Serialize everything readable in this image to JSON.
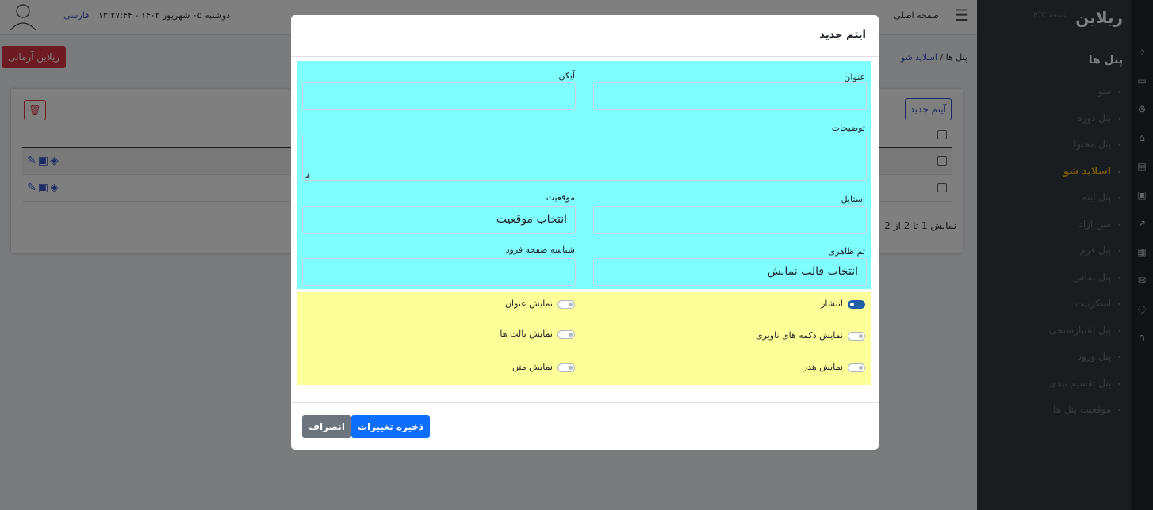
{
  "header": {
    "language": "فارسی",
    "datetime": "دوشنبه ۰۵ شهریور ۱۴۰۳ - ۱۳:۲۷:۴۴",
    "home_link": "صفحه اصلی"
  },
  "subbar": {
    "brand_button": "ریلاین آرمانی",
    "breadcrumb_parent": "پنل ها",
    "breadcrumb_separator": "/",
    "breadcrumb_current": "اسلاید شو"
  },
  "card": {
    "new_item_button": "آیتم جدید",
    "pager_text": "نمایش 1 تا 2 از 2"
  },
  "sidebar": {
    "logo": "ریلاین",
    "version": "نسخه PTC",
    "title": "پنل ها",
    "items": [
      {
        "label": "منو"
      },
      {
        "label": "پنل دوره"
      },
      {
        "label": "پنل محتوا"
      },
      {
        "label": "اسلاید شو",
        "active": true
      },
      {
        "label": "پنل آیتم"
      },
      {
        "label": "متن آزاد"
      },
      {
        "label": "پنل فرم"
      },
      {
        "label": "پنل تماس"
      },
      {
        "label": "اسکریپت"
      },
      {
        "label": "پنل اعتبارسنجی"
      },
      {
        "label": "پنل ورود"
      },
      {
        "label": "پنل تقسیم بندی"
      },
      {
        "label": "موقعیت پنل ها"
      }
    ]
  },
  "modal": {
    "title": "آیتم جدید",
    "fields": {
      "title_label": "عنوان",
      "title_value": "",
      "icon_label": "آیکن",
      "icon_value": "",
      "description_label": "توضیحات",
      "description_value": "",
      "style_label": "استایل",
      "style_value": "",
      "position_label": "موقعیت",
      "position_value": "انتخاب موقعیت",
      "theme_label": "تم ظاهری",
      "theme_value": "انتخاب قالب نمایش",
      "landing_label": "شناسه صفحه فرود",
      "landing_value": ""
    },
    "toggles": {
      "publish": {
        "label": "انتشار",
        "on": true
      },
      "show_title": {
        "label": "نمایش عنوان",
        "on": false
      },
      "show_nav_buttons": {
        "label": "نمایش دکمه های ناوبری",
        "on": false
      },
      "show_bullets": {
        "label": "نمایش بالت ها",
        "on": false
      },
      "show_header": {
        "label": "نمایش هدر",
        "on": false
      },
      "show_text": {
        "label": "نمایش متن",
        "on": false
      }
    },
    "save_button": "ذخیره تغییرات",
    "cancel_button": "انصراف"
  },
  "colors": {
    "form_bg": "#80ffff",
    "toggle_bg": "#ffff99",
    "primary": "#0d6efd",
    "danger": "#dc3545",
    "sidebar_bg": "#343a40",
    "active_item": "#f0b400"
  }
}
